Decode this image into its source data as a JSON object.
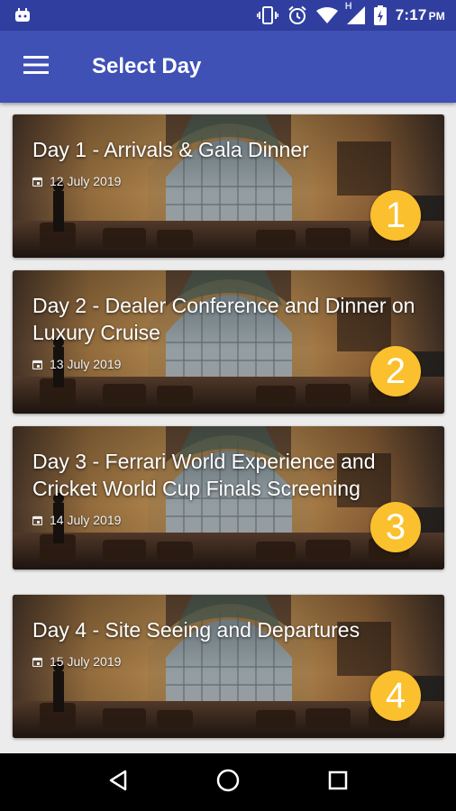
{
  "status_bar": {
    "time": "7:17",
    "ampm": "PM",
    "network_label": "H",
    "icons": [
      "android-debug-icon",
      "vibrate-icon",
      "alarm-icon",
      "wifi-icon",
      "signal-icon",
      "battery-charging-icon"
    ]
  },
  "app_bar": {
    "title": "Select Day",
    "menu_icon": "hamburger-menu-icon",
    "color": "#3f51b5",
    "status_color": "#303f9f"
  },
  "days": [
    {
      "title": "Day 1 - Arrivals & Gala Dinner",
      "date": "12 July 2019",
      "number": "1"
    },
    {
      "title": "Day 2 - Dealer Conference and Dinner on Luxury Cruise",
      "date": "13 July 2019",
      "number": "2"
    },
    {
      "title": "Day 3 - Ferrari World Experience and Cricket World Cup Finals Screening",
      "date": "14 July 2019",
      "number": "3"
    },
    {
      "title": "Day 4 - Site Seeing and Departures",
      "date": "15 July 2019",
      "number": "4"
    }
  ],
  "badge_color": "#fbc02d",
  "nav_bar": {
    "icons": [
      "back-icon",
      "home-icon",
      "recents-icon"
    ]
  }
}
